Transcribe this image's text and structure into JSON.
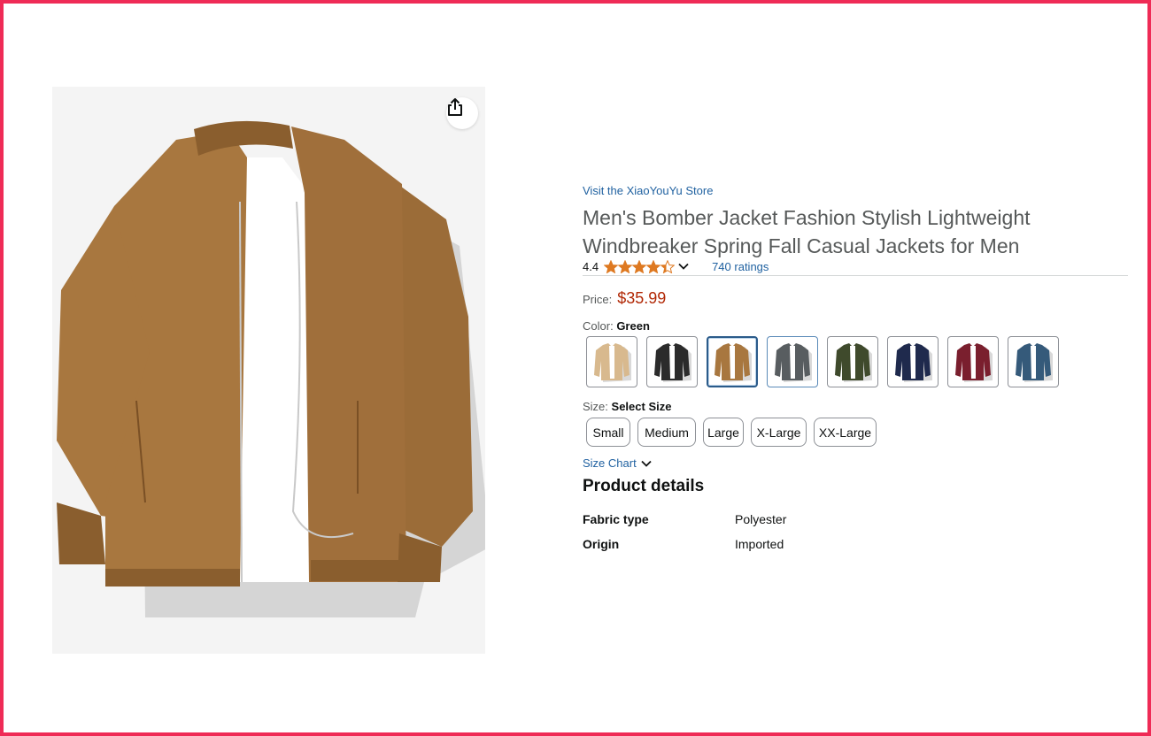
{
  "product": {
    "store_link": "Visit the XiaoYouYu Store",
    "title_line1": "Men's Bomber Jacket Fashion Stylish Lightweight",
    "title_line2": "Windbreaker Spring Fall Casual Jackets for Men",
    "rating_value": "4.4",
    "rating_stars": 4.4,
    "ratings_count": "740 ratings",
    "price_label": "Price:",
    "price": "$35.99"
  },
  "color": {
    "label": "Color:",
    "selected_name": "Green",
    "swatches": [
      {
        "color": "#d8b98e"
      },
      {
        "color": "#2b2b2b"
      },
      {
        "color": "#a8773f"
      },
      {
        "color": "#585d60"
      },
      {
        "color": "#3f4a2c"
      },
      {
        "color": "#1f2a4d"
      },
      {
        "color": "#7a1f2e"
      },
      {
        "color": "#355a7a"
      }
    ]
  },
  "size": {
    "label": "Size:",
    "selected_name": "Select Size",
    "options": [
      "Small",
      "Medium",
      "Large",
      "X-Large",
      "XX-Large"
    ],
    "chart_link": "Size Chart"
  },
  "details": {
    "heading": "Product details",
    "rows": [
      {
        "key": "Fabric type",
        "value": "Polyester"
      },
      {
        "key": "Origin",
        "value": "Imported"
      }
    ]
  },
  "icons": {
    "share": "share-icon",
    "chevron": "chevron-down-icon",
    "star": "star-icon"
  },
  "colors": {
    "link": "#2162a1",
    "price": "#b12704",
    "star": "#de7921",
    "frame": "#ef2b56"
  }
}
